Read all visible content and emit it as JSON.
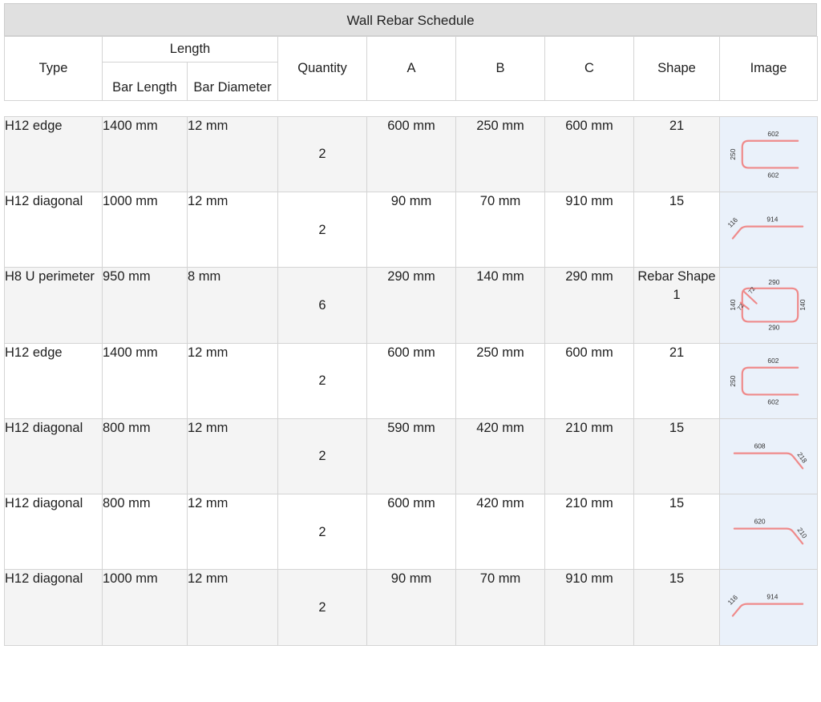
{
  "title": "Wall Rebar Schedule",
  "columns": {
    "type": "Type",
    "length_group": "Length",
    "bar_length": "Bar Length",
    "bar_diameter": "Bar Diameter",
    "quantity": "Quantity",
    "a": "A",
    "b": "B",
    "c": "C",
    "shape": "Shape",
    "image": "Image"
  },
  "colors": {
    "title_bar": "#e0e0e0",
    "grid_line": "#d4d4d4",
    "alt_row": "#f4f4f4",
    "image_cell_bg": "#eaf1fa",
    "rebar_stroke": "#ef8a8a",
    "dimension_text": "#333333"
  },
  "rows": [
    {
      "type": "H12 edge",
      "bar_length": "1400 mm",
      "bar_diameter": "12 mm",
      "quantity": "2",
      "a": "600 mm",
      "b": "250 mm",
      "c": "600 mm",
      "shape": "21",
      "image": {
        "kind": "u-shape-horizontal",
        "labels": {
          "top": "602",
          "left": "250",
          "bottom": "602"
        }
      }
    },
    {
      "type": "H12 diagonal",
      "bar_length": "1000 mm",
      "bar_diameter": "12 mm",
      "quantity": "2",
      "a": "90 mm",
      "b": "70 mm",
      "c": "910 mm",
      "shape": "15",
      "image": {
        "kind": "bent-bar-left-kick",
        "labels": {
          "diagonal": "116",
          "horizontal": "914"
        }
      }
    },
    {
      "type": "H8 U perimeter",
      "bar_length": "950 mm",
      "bar_diameter": "8 mm",
      "quantity": "6",
      "a": "290 mm",
      "b": "140 mm",
      "c": "290 mm",
      "shape": "Rebar Shape 1",
      "image": {
        "kind": "closed-link",
        "labels": {
          "top": "290",
          "bottom": "290",
          "left": "140",
          "right": "140",
          "hook_a": "72",
          "hook_b": "72"
        }
      }
    },
    {
      "type": "H12 edge",
      "bar_length": "1400 mm",
      "bar_diameter": "12 mm",
      "quantity": "2",
      "a": "600 mm",
      "b": "250 mm",
      "c": "600 mm",
      "shape": "21",
      "image": {
        "kind": "u-shape-horizontal",
        "labels": {
          "top": "602",
          "left": "250",
          "bottom": "602"
        }
      }
    },
    {
      "type": "H12 diagonal",
      "bar_length": "800 mm",
      "bar_diameter": "12 mm",
      "quantity": "2",
      "a": "590 mm",
      "b": "420 mm",
      "c": "210 mm",
      "shape": "15",
      "image": {
        "kind": "bent-bar-right-drop",
        "labels": {
          "horizontal": "608",
          "diagonal": "218"
        }
      }
    },
    {
      "type": "H12 diagonal",
      "bar_length": "800 mm",
      "bar_diameter": "12 mm",
      "quantity": "2",
      "a": "600 mm",
      "b": "420 mm",
      "c": "210 mm",
      "shape": "15",
      "image": {
        "kind": "bent-bar-right-drop",
        "labels": {
          "horizontal": "620",
          "diagonal": "210"
        }
      }
    },
    {
      "type": "H12 diagonal",
      "bar_length": "1000 mm",
      "bar_diameter": "12 mm",
      "quantity": "2",
      "a": "90 mm",
      "b": "70 mm",
      "c": "910 mm",
      "shape": "15",
      "image": {
        "kind": "bent-bar-left-kick",
        "labels": {
          "diagonal": "116",
          "horizontal": "914"
        }
      }
    }
  ]
}
